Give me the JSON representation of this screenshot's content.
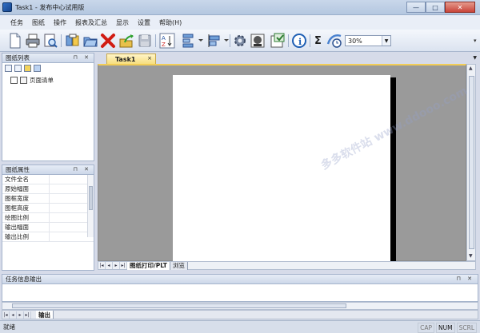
{
  "window": {
    "title": "Task1 - 发布中心试用版",
    "buttons": {
      "minimize": "—",
      "maximize": "□",
      "close": "✕"
    }
  },
  "menu": [
    "任务",
    "图纸",
    "操作",
    "报表及汇总",
    "显示",
    "设置",
    "帮助(H)"
  ],
  "toolbar": {
    "icons": [
      "new-document-icon",
      "printer-icon",
      "print-preview-icon",
      "batch-icon",
      "open-folder-icon",
      "delete-icon",
      "export-icon",
      "save-icon",
      "sort-az-icon",
      "layout-icon",
      "align-icon",
      "settings-icon",
      "stamp-icon",
      "publish-icon",
      "info-icon",
      "sigma-icon",
      "clock-icon"
    ],
    "sigma": "Σ",
    "info": "i",
    "zoom_value": "30%",
    "overflow": "▾"
  },
  "drawing_list": {
    "title": "图纸列表",
    "pin": "⊓",
    "close": "✕",
    "tree_root": "页面清单"
  },
  "properties": {
    "title": "图纸属性",
    "rows": [
      "文件全名",
      "原始幅面",
      "图框宽度",
      "图框高度",
      "绘图比例",
      "输出幅面",
      "输出比例"
    ]
  },
  "document": {
    "tab_label": "Task1",
    "tab_close": "×",
    "sheet_tabs": [
      "图纸打印/PLT",
      "浏览"
    ]
  },
  "output": {
    "title": "任务信息输出",
    "tab": "输出"
  },
  "status": {
    "text": "就绪",
    "keys": [
      "CAP",
      "NUM",
      "SCRL"
    ]
  },
  "nav": {
    "first": "|◂",
    "prev": "◂",
    "next": "▸",
    "last": "▸|"
  },
  "colors": {
    "tab_active": "#f7de7e",
    "canvas": "#9a9a9a",
    "accent": "#f2cd56"
  },
  "watermark": "多多软件站 www.ddooo.com"
}
